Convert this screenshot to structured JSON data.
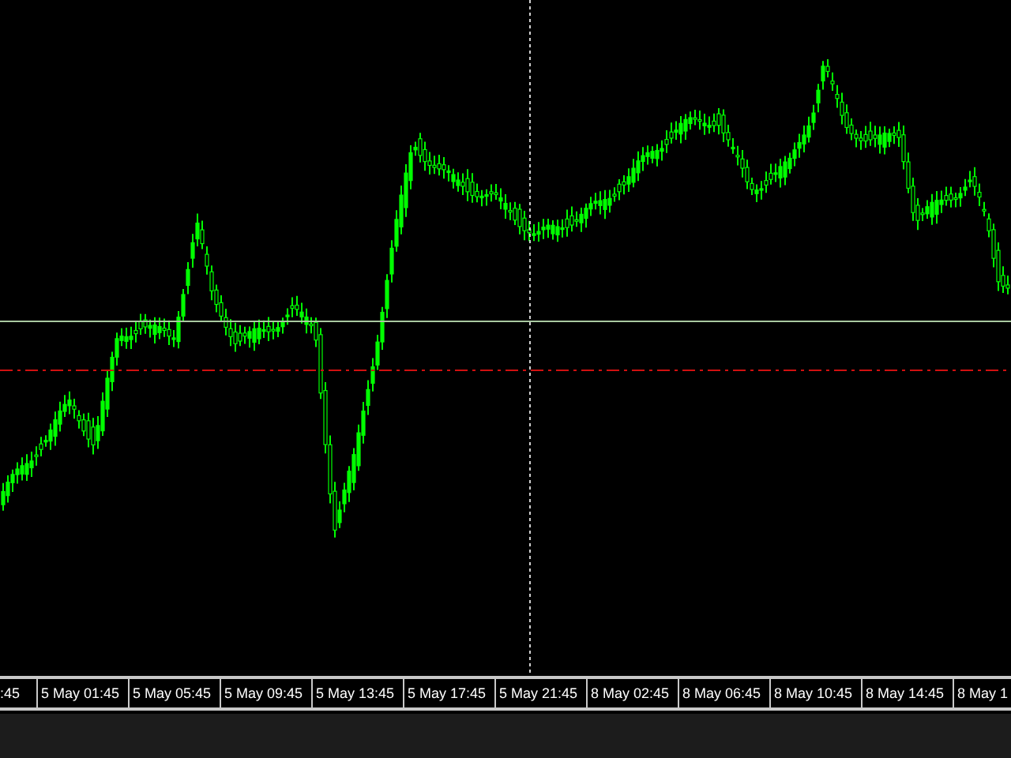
{
  "chart": {
    "time_labels": [
      ":45",
      "5 May 01:45",
      "5 May 05:45",
      "5 May 09:45",
      "5 May 13:45",
      "5 May 17:45",
      "5 May 21:45",
      "8 May 02:45",
      "8 May 06:45",
      "8 May 10:45",
      "8 May 14:45",
      "8 May 1"
    ]
  }
}
